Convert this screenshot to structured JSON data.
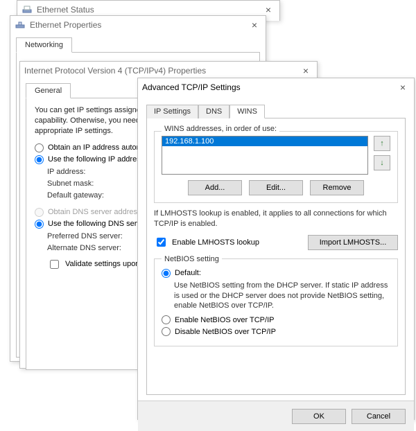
{
  "window_status": {
    "title": "Ethernet Status"
  },
  "window_props": {
    "title": "Ethernet Properties",
    "tab_networking": "Networking"
  },
  "window_ipv4": {
    "title": "Internet Protocol Version 4 (TCP/IPv4) Properties",
    "tab_general": "General",
    "intro": "You can get IP settings assigned automatically if your network supports this capability. Otherwise, you need to ask your network administrator for the appropriate IP settings.",
    "opt_auto_ip": "Obtain an IP address automatically",
    "opt_manual_ip": "Use the following IP address:",
    "lbl_ip": "IP address:",
    "lbl_subnet": "Subnet mask:",
    "lbl_gateway": "Default gateway:",
    "opt_auto_dns": "Obtain DNS server address automatically",
    "opt_manual_dns": "Use the following DNS server addresses:",
    "lbl_pref_dns": "Preferred DNS server:",
    "lbl_alt_dns": "Alternate DNS server:",
    "chk_validate": "Validate settings upon exit"
  },
  "window_adv": {
    "title": "Advanced TCP/IP Settings",
    "tabs": {
      "ip": "IP Settings",
      "dns": "DNS",
      "wins": "WINS"
    },
    "wins": {
      "list_label": "WINS addresses, in order of use:",
      "addresses": [
        "192.168.1.100"
      ],
      "btn_add": "Add...",
      "btn_edit": "Edit...",
      "btn_remove": "Remove",
      "lmhosts_note": "If LMHOSTS lookup is enabled, it applies to all connections for which TCP/IP is enabled.",
      "chk_lmhosts": "Enable LMHOSTS lookup",
      "btn_import": "Import LMHOSTS...",
      "netbios_legend": "NetBIOS setting",
      "opt_default": "Default:",
      "default_text": "Use NetBIOS setting from the DHCP server. If static IP address is used or the DHCP server does not provide NetBIOS setting, enable NetBIOS over TCP/IP.",
      "opt_enable": "Enable NetBIOS over TCP/IP",
      "opt_disable": "Disable NetBIOS over TCP/IP"
    },
    "btn_ok": "OK",
    "btn_cancel": "Cancel"
  }
}
